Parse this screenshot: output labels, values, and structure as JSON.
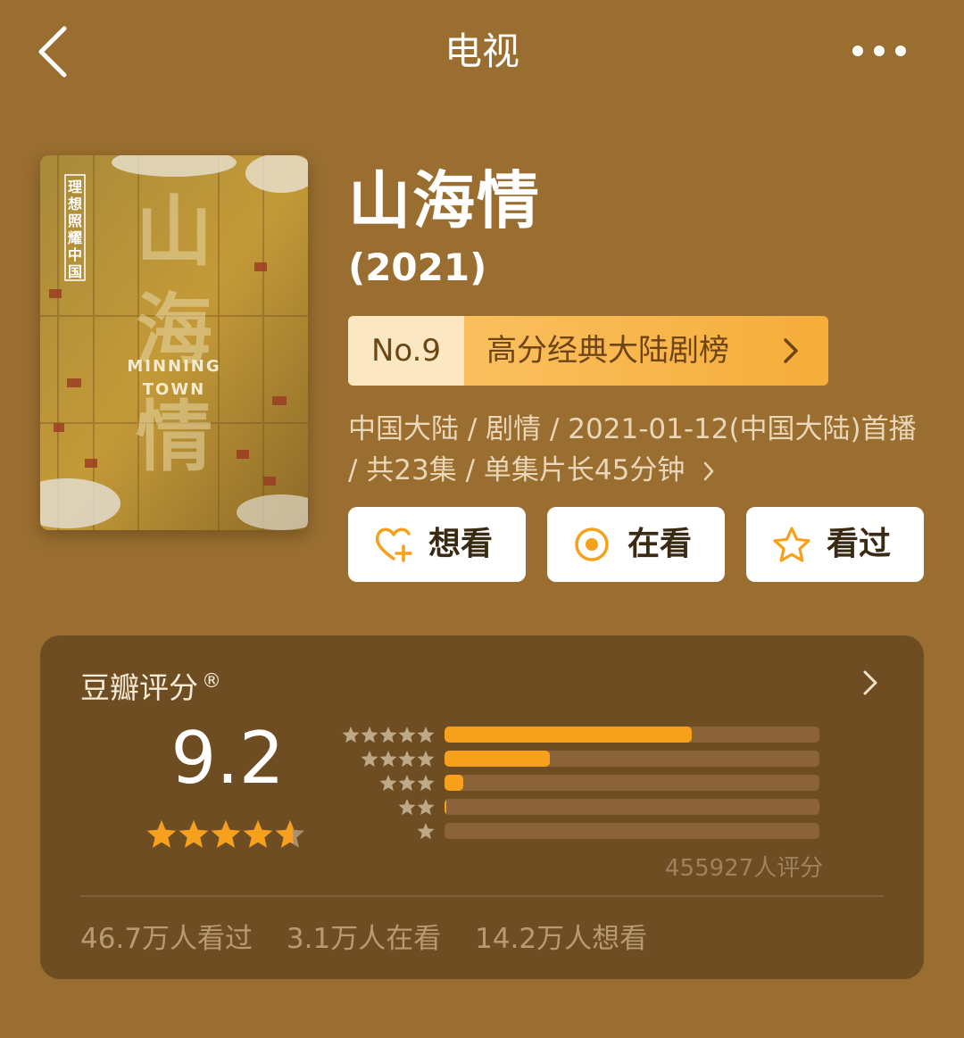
{
  "header": {
    "title": "电视",
    "back_icon": "chevron-left-icon",
    "more_icon": "more-dots-icon"
  },
  "show": {
    "title": "山海情",
    "year": "(2021)"
  },
  "poster": {
    "vertical_text": [
      "理",
      "想",
      "照",
      "耀",
      "中",
      "国"
    ],
    "big_chars": [
      "山",
      "海",
      "情"
    ],
    "english_line1": "MINNING",
    "english_line2": "TOWN"
  },
  "rank": {
    "no": "No.9",
    "name": "高分经典大陆剧榜",
    "chevron": "›"
  },
  "meta": {
    "text": "中国大陆 / 剧情 / 2021-01-12(中国大陆)首播 / 共23集 / 单集片长45分钟"
  },
  "actions": {
    "want": {
      "label": "想看",
      "icon": "heart-plus-icon"
    },
    "watching": {
      "label": "在看",
      "icon": "target-icon"
    },
    "watched": {
      "label": "看过",
      "icon": "star-icon"
    }
  },
  "rating": {
    "title": "豆瓣评分",
    "mark": "®",
    "score": "9.2",
    "stars_value": 4.6,
    "distribution": [
      {
        "stars": 5,
        "fraction": 0.66
      },
      {
        "stars": 4,
        "fraction": 0.28
      },
      {
        "stars": 3,
        "fraction": 0.05
      },
      {
        "stars": 2,
        "fraction": 0.005
      },
      {
        "stars": 1,
        "fraction": 0.0
      }
    ],
    "count": "455927人评分",
    "stats": [
      "46.7万人看过",
      "3.1万人在看",
      "14.2万人想看"
    ]
  },
  "colors": {
    "background": "#9a6e30",
    "panel": "#6f4d23",
    "accent": "#f7a01c",
    "rank_gradient_start": "#fbc56a"
  }
}
